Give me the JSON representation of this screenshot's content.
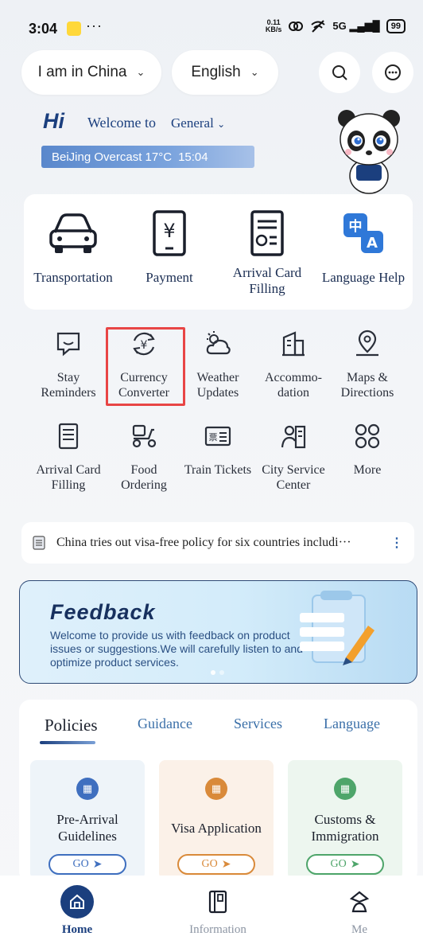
{
  "status_bar": {
    "time": "3:04",
    "dots": "···",
    "net_speed_value": "0.11",
    "net_speed_unit": "KB/s",
    "signal": "5G",
    "battery": "99"
  },
  "header": {
    "location_label": "I am in China",
    "language_label": "English",
    "search_icon": "search-icon",
    "chat_icon": "chat-icon"
  },
  "welcome": {
    "hi": "Hi",
    "text": "Welcome to",
    "mode": "General",
    "weather": "BeiJing Overcast 17°C",
    "weather_time": "15:04"
  },
  "main_services": [
    {
      "label": "Transportation",
      "icon": "car-icon"
    },
    {
      "label": "Payment",
      "icon": "yuan-phone-icon"
    },
    {
      "label": "Arrival Card Filling",
      "icon": "form-icon"
    },
    {
      "label": "Language Help",
      "icon": "translate-icon"
    }
  ],
  "grid_services": [
    {
      "label": "Stay Reminders",
      "icon": "chat-bubble-icon"
    },
    {
      "label": "Currency Converter",
      "icon": "currency-exchange-icon"
    },
    {
      "label": "Weather Updates",
      "icon": "weather-icon"
    },
    {
      "label": "Accommo-dation",
      "icon": "building-icon"
    },
    {
      "label": "Maps & Directions",
      "icon": "map-pin-icon"
    },
    {
      "label": "Arrival Card Filling",
      "icon": "card-icon"
    },
    {
      "label": "Food Ordering",
      "icon": "scooter-icon"
    },
    {
      "label": "Train Tickets",
      "icon": "ticket-icon"
    },
    {
      "label": "City Service Center",
      "icon": "city-service-icon"
    },
    {
      "label": "More",
      "icon": "more-icon"
    }
  ],
  "news": {
    "text": "China tries out visa-free policy for six countries includi···"
  },
  "feedback": {
    "title": "Feedback",
    "desc": "Welcome to provide us with feedback on product issues or suggestions.We will carefully listen to and optimize product services."
  },
  "policy_tabs": [
    "Policies",
    "Guidance",
    "Services",
    "Language"
  ],
  "policy_cards": [
    {
      "label": "Pre-Arrival Guidelines",
      "go": "GO",
      "color": "#3f6fbf",
      "bg": "#eef4f9"
    },
    {
      "label": "Visa Application",
      "go": "GO",
      "color": "#d98a3a",
      "bg": "#fbf1e8"
    },
    {
      "label": "Customs & Immigration",
      "go": "GO",
      "color": "#4ea56a",
      "bg": "#edf6ef"
    }
  ],
  "bottom_nav": [
    {
      "label": "Home",
      "icon": "home-icon"
    },
    {
      "label": "Information",
      "icon": "book-icon"
    },
    {
      "label": "Me",
      "icon": "person-icon"
    }
  ],
  "colors": {
    "brand": "#1b3f7e",
    "highlight": "#e84545"
  }
}
